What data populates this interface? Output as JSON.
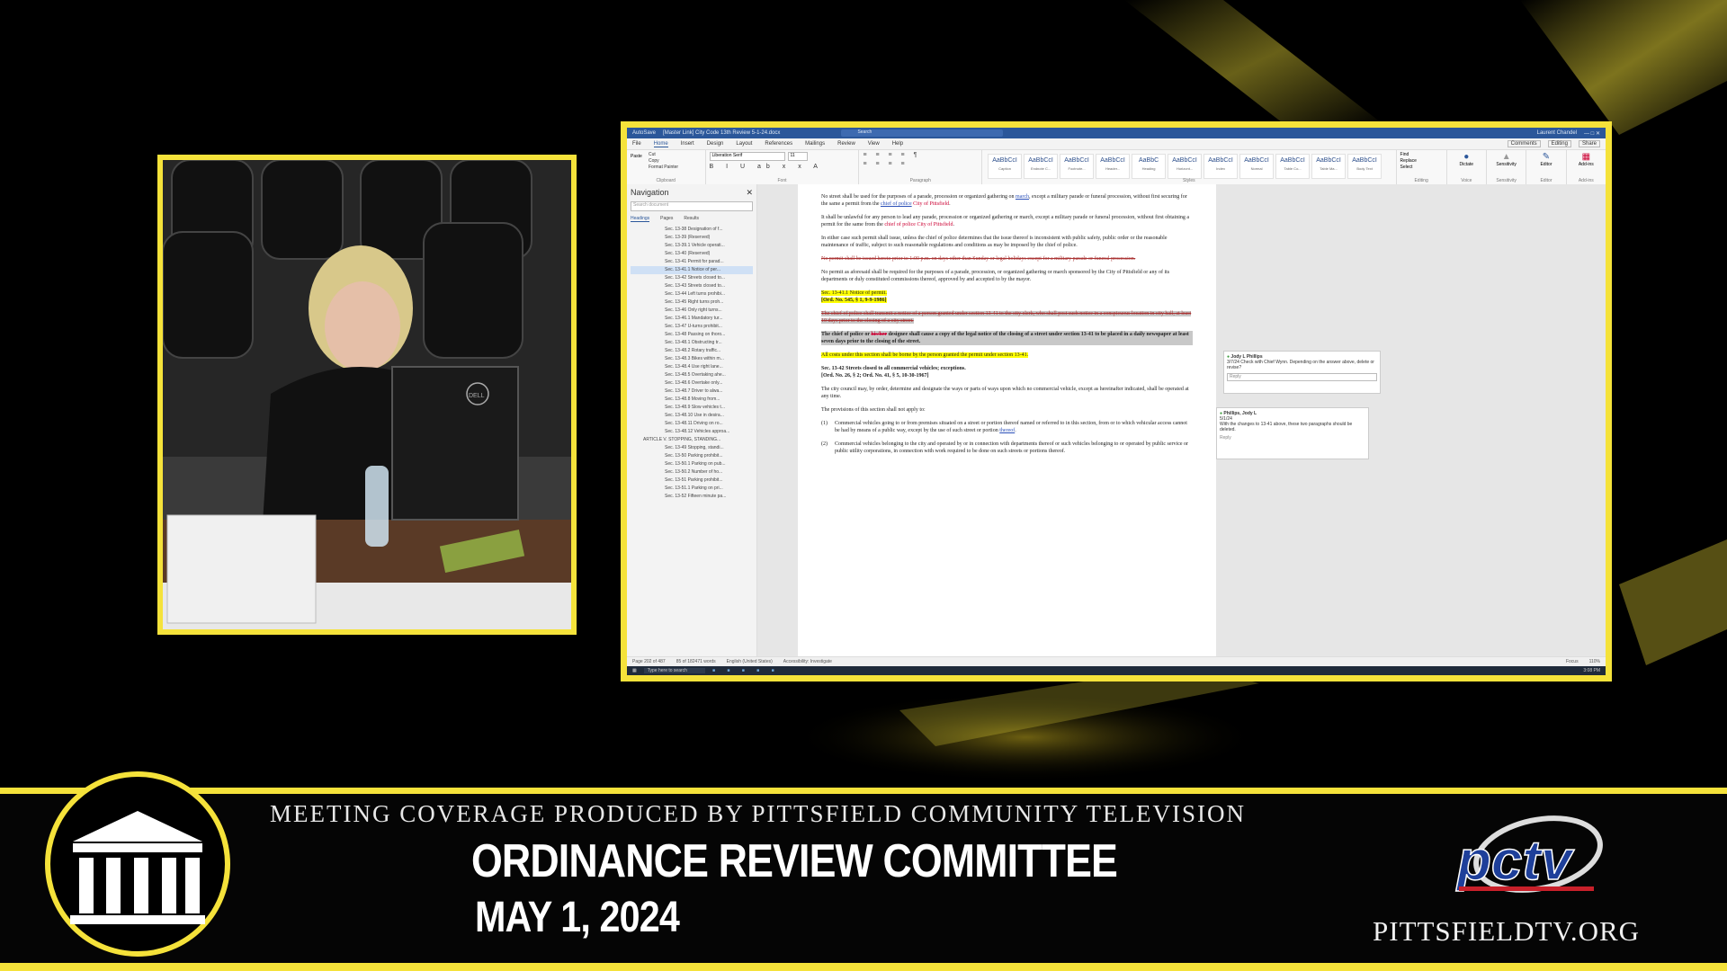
{
  "broadcast": {
    "tagline": "MEETING COVERAGE PRODUCED BY PITTSFIELD COMMUNITY TELEVISION",
    "title": "ORDINANCE REVIEW COMMITTEE",
    "date": "MAY 1, 2024",
    "website": "PITTSFIELDTV.ORG",
    "logo_text": "pctv",
    "accent_color": "#f5e23a"
  },
  "camera": {
    "monitor_brand": "DELL"
  },
  "word": {
    "title_left": "AutoSave",
    "title_doc": "[Master Link] City Code 13th Review 5-1-24.docx",
    "search_placeholder": "Search",
    "user": "Laurent Chandel",
    "menu": [
      "File",
      "Home",
      "Insert",
      "Design",
      "Layout",
      "References",
      "Mailings",
      "Review",
      "View",
      "Help"
    ],
    "menu_active": "Home",
    "right_buttons": [
      "Comments",
      "Editing",
      "Share"
    ],
    "font_name": "Liberation Serif",
    "font_size": "11",
    "groups": [
      "Clipboard",
      "Font",
      "Paragraph",
      "Styles",
      "Editing",
      "Voice",
      "Sensitivity",
      "Editor",
      "Add-ins"
    ],
    "clipboard": [
      "Cut",
      "Copy",
      "Format Painter",
      "Paste"
    ],
    "editing": [
      "Find",
      "Replace",
      "Select"
    ],
    "ribbon_right": [
      "Dictate",
      "Sensitivity",
      "Editor",
      "Add-ins"
    ],
    "styles": [
      {
        "sample": "AaBbCcI",
        "name": "Caption"
      },
      {
        "sample": "AaBbCcI",
        "name": "Endnote C..."
      },
      {
        "sample": "AaBbCcI",
        "name": "Footnote..."
      },
      {
        "sample": "AaBbCcI",
        "name": "Header..."
      },
      {
        "sample": "AaBbC",
        "name": "Heading"
      },
      {
        "sample": "AaBbCcI",
        "name": "Horizont..."
      },
      {
        "sample": "AaBbCcI",
        "name": "Index"
      },
      {
        "sample": "AaBbCcI",
        "name": "Normal"
      },
      {
        "sample": "AaBbCcI",
        "name": "Table Co..."
      },
      {
        "sample": "AaBbCcI",
        "name": "Table Ma..."
      },
      {
        "sample": "AaBbCcI",
        "name": "Body Text"
      }
    ]
  },
  "navigation": {
    "title": "Navigation",
    "search_placeholder": "Search document",
    "tabs": [
      "Headings",
      "Pages",
      "Results"
    ],
    "items": [
      "Sec. 13-38 Designation of f...",
      "Sec. 13-39 (Reserved)",
      "Sec. 13-39.1 Vehicle operati...",
      "Sec. 13-40 (Reserved)",
      "Sec. 13-41 Permit for parad...",
      "Sec. 13-41.1 Notice of per...",
      "Sec. 13-42 Streets closed to...",
      "Sec. 13-43 Streets closed to...",
      "Sec. 13-44 Left turns prohibi...",
      "Sec. 13-45 Right turns proh...",
      "Sec. 13-46 Only right turns...",
      "Sec. 13-46.1 Mandatory tur...",
      "Sec. 13-47 U-turns prohibit...",
      "Sec. 13-48 Passing on thoro...",
      "Sec. 13-48.1 Obstructing tr...",
      "Sec. 13-48.2 Rotary traffic...",
      "Sec. 13-48.3 Bikes within m...",
      "Sec. 13-48.4 Use right lane...",
      "Sec. 13-48.5 Overtaking ahe...",
      "Sec. 13-48.6 Overtake only...",
      "Sec. 13-48.7 Driver to alwa...",
      "Sec. 13-48.8 Moving from...",
      "Sec. 13-48.9 Slow vehicles t...",
      "Sec. 13-48.10 Use in desira...",
      "Sec. 13-48.11 Driving on ro...",
      "Sec. 13-48.12 Vehicles approa...",
      "ARTICLE V. STOPPING, STANDING...",
      "Sec. 13-49 Stopping, standi...",
      "Sec. 13-50 Parking prohibit...",
      "Sec. 13-50.1 Parking on pub...",
      "Sec. 13-50.2 Number of ho...",
      "Sec. 13-51 Parking prohibit...",
      "Sec. 13-51.1 Parking on pri...",
      "Sec. 13-52 Fifteen minute pa..."
    ],
    "selected_index": 5,
    "article_index": 26
  },
  "document": {
    "p1a": "No street shall be used for the purposes of a parade, procession or organized gathering on",
    "p1_u": "march",
    "p1b": ", except a military parade or funeral procession, without first securing for the same a permit from the",
    "p1_u2": "chief of police",
    "p1_red": "City of Pittsfield",
    "p2": "It shall be unlawful for any person to lead any parade, procession or organized gathering or march, except a military parade or funeral procession, without first obtaining a permit for the same from the",
    "p2_u": "chief of police City of Pittsfield",
    "p3": "In either case such permit shall issue, unless the chief of police determines that the issue thereof is inconsistent with public safety, public order or the reasonable maintenance of traffic, subject to such reasonable regulations and conditions as may be imposed by the chief of police.",
    "p4_strike": "No permit shall be issued hereto prior to 1:00 p.m. on days other than Sunday or legal holidays except for a military parade or funeral procession.",
    "p5": "No permit as aforesaid shall be required for the purposes of a parade, procession, or organized gathering or march sponsored by the City of Pittsfield or any of its departments or duly constituted commissions thereof, approved by and accepted to by the mayor.",
    "sec1_heading": "Sec. 13-41.1 Notice of permit.",
    "sec1_ord": "[Ord. No. 545, § 1, 9-9-1986]",
    "p6_strike": "The chief of police shall transmit a notice of a person granted under section 13-41 to the city clerk, who shall post such notice in a conspicuous location in city hall, at least 10 days prior to the closing of a city street.",
    "p7a": "The chief of police or",
    "p7_red": "his/her",
    "p7b": "designee shall cause a copy of the legal notice of the closing of a street under section 13-41 to be placed in a daily newspaper at least seven days prior to the closing of the street.",
    "p8": "All costs under this section shall be borne by the person granted the permit under section 13-41.",
    "sec2_heading": "Sec. 13-42 Streets closed to all commercial vehicles; exceptions.",
    "sec2_ord": "[Ord. No. 26, § 2; Ord. No. 41, § 5, 10-30-1967]",
    "p9": "The city council may, by order, determine and designate the ways or parts of ways upon which no commercial vehicle, except as hereinafter indicated, shall be operated at any time.",
    "p10": "The provisions of this section shall not apply to:",
    "li1_num": "(1)",
    "li1a": "Commercial vehicles going to or from premises situated on a street or portion thereof named or referred to in this section, from or to which vehicular access cannot be had by means of a public way, except by the use of such street or portion",
    "li1_u": "thereof",
    "li2_num": "(2)",
    "li2": "Commercial vehicles belonging to the city and operated by or in connection with departments thereof or such vehicles belonging to or operated by public service or public utility corporations, in connection with work required to be done on such streets or portions thereof."
  },
  "comments": [
    {
      "author": "Jody L Phillips",
      "text": "3/7/24 Check with Chief Wynn. Depending on the answer above, delete or revise?",
      "reply": "Reply"
    },
    {
      "author": "Phillips, Jody L",
      "date": "5/1/24",
      "text": "With the changes to 13-41 above, these two paragraphs should be deleted.",
      "reply": "Reply"
    }
  ],
  "status": {
    "page": "Page 202 of 487",
    "words": "85 of 182471 words",
    "language": "English (United States)",
    "accessibility": "Accessibility: Investigate",
    "focus": "Focus",
    "zoom": "110%"
  },
  "taskbar": {
    "search": "Type here to search",
    "time": "3:08 PM"
  }
}
